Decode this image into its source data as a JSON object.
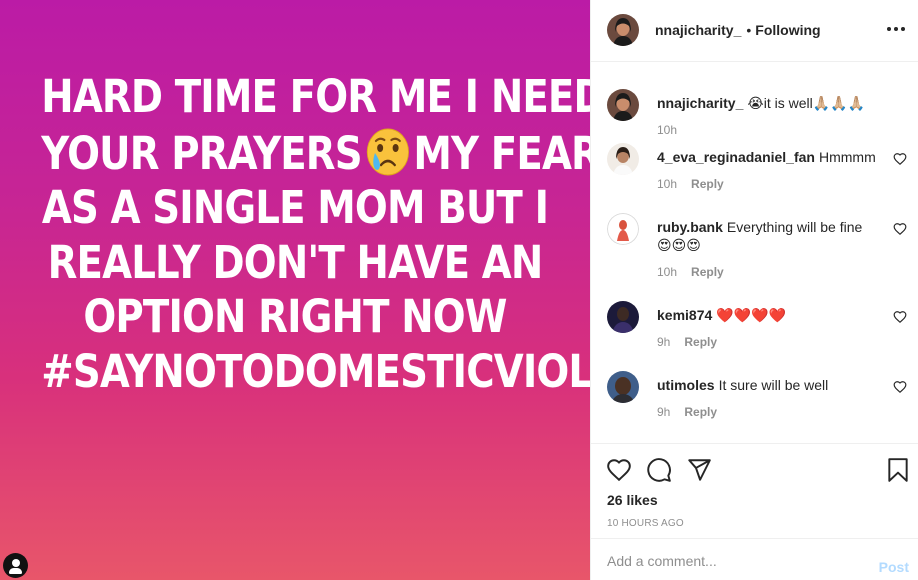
{
  "post": {
    "text_lines": [
      "HARD TIME FOR ME I NEED",
      "YOUR PRAYERS",
      "MY FEARS",
      "AS A SINGLE MOM BUT I",
      "REALLY DON'T HAVE AN",
      "OPTION RIGHT NOW",
      "#SAYNOTODOMESTICVIOLENC"
    ],
    "emoji": "crying-face-emoji",
    "tag_icon": "user-tag-icon"
  },
  "header": {
    "username": "nnajicharity_",
    "separator": "•",
    "follow_status": "Following",
    "more_icon": "more-options-icon"
  },
  "comments": [
    {
      "user": "nnajicharity_",
      "text": "😭it is well🙏🏼🙏🏼🙏🏼",
      "time": "10h",
      "reply": ""
    },
    {
      "user": "4_eva_reginadaniel_fan",
      "text": "Hmmmm",
      "time": "10h",
      "reply": "Reply"
    },
    {
      "user": "ruby.bank",
      "text": "Everything will be fine 😍😍😍",
      "time": "10h",
      "reply": "Reply"
    },
    {
      "user": "kemi874",
      "text": "❤️❤️❤️❤️",
      "time": "9h",
      "reply": "Reply"
    },
    {
      "user": "utimoles",
      "text": "It sure will be well",
      "time": "9h",
      "reply": "Reply"
    }
  ],
  "actions": {
    "icons": [
      "heart-icon",
      "comment-icon",
      "share-icon",
      "bookmark-icon"
    ],
    "likes": "26 likes",
    "timestamp": "10 HOURS AGO"
  },
  "composer": {
    "placeholder": "Add a comment...",
    "post_label": "Post"
  },
  "colors": {
    "gradient_top": "#bb1ba6",
    "gradient_bottom": "#e8566a",
    "post_button": "#b3dbff",
    "meta_text": "#8e8e8e"
  }
}
